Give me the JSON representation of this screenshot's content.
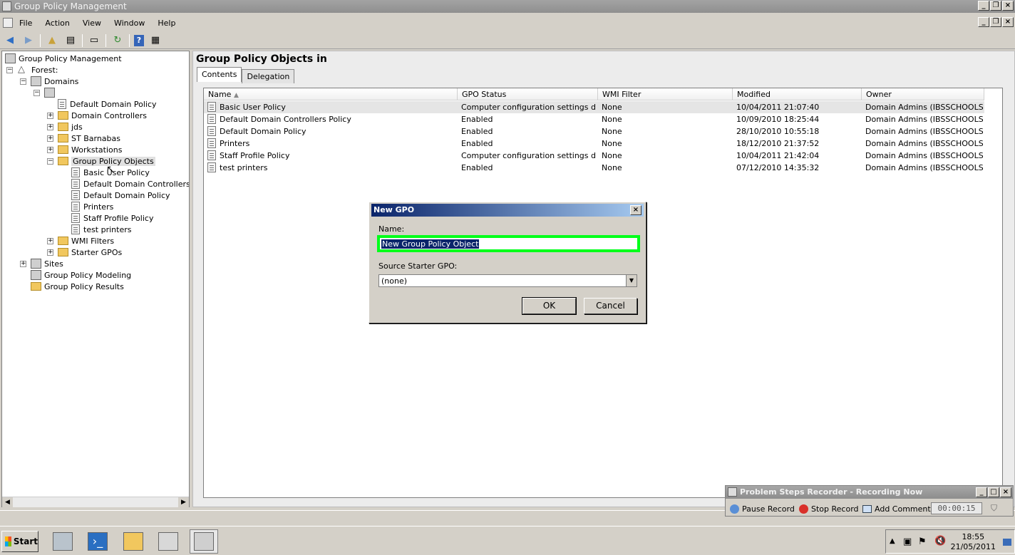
{
  "window": {
    "title": "Group Policy Management"
  },
  "menu": [
    "File",
    "Action",
    "View",
    "Window",
    "Help"
  ],
  "toolbar_icons": [
    "back-arrow-icon",
    "forward-arrow-icon",
    "up-folder-icon",
    "show-hide-tree-icon",
    "properties-icon",
    "refresh-icon",
    "help-icon",
    "console-icon"
  ],
  "tree": {
    "root": "Group Policy Management",
    "forest": "Forest:",
    "domains": "Domains",
    "domain_children": [
      "Default Domain Policy",
      "Domain Controllers",
      "jds",
      "ST Barnabas",
      "Workstations",
      "Group Policy Objects"
    ],
    "gpo_children": [
      "Basic User Policy",
      "Default Domain Controllers Pol",
      "Default Domain Policy",
      "Printers",
      "Staff Profile Policy",
      "test printers"
    ],
    "after_gpo": [
      "WMI Filters",
      "Starter GPOs"
    ],
    "sites": "Sites",
    "modeling": "Group Policy Modeling",
    "results": "Group Policy Results"
  },
  "content": {
    "title": "Group Policy Objects in",
    "tabs": [
      "Contents",
      "Delegation"
    ],
    "columns": [
      "Name",
      "GPO Status",
      "WMI Filter",
      "Modified",
      "Owner"
    ],
    "rows": [
      {
        "name": "Basic User Policy",
        "status": "Computer configuration settings disab...",
        "wmi": "None",
        "modified": "10/04/2011 21:07:40",
        "owner": "Domain Admins (IBSSCHOOLS..."
      },
      {
        "name": "Default Domain Controllers Policy",
        "status": "Enabled",
        "wmi": "None",
        "modified": "10/09/2010 18:25:44",
        "owner": "Domain Admins (IBSSCHOOLS..."
      },
      {
        "name": "Default Domain Policy",
        "status": "Enabled",
        "wmi": "None",
        "modified": "28/10/2010 10:55:18",
        "owner": "Domain Admins (IBSSCHOOLS..."
      },
      {
        "name": "Printers",
        "status": "Enabled",
        "wmi": "None",
        "modified": "18/12/2010 21:37:52",
        "owner": "Domain Admins (IBSSCHOOLS..."
      },
      {
        "name": "Staff Profile Policy",
        "status": "Computer configuration settings disab...",
        "wmi": "None",
        "modified": "10/04/2011 21:42:04",
        "owner": "Domain Admins (IBSSCHOOLS..."
      },
      {
        "name": "test printers",
        "status": "Enabled",
        "wmi": "None",
        "modified": "07/12/2010 14:35:32",
        "owner": "Domain Admins (IBSSCHOOLS..."
      }
    ]
  },
  "dialog": {
    "title": "New GPO",
    "name_label": "Name:",
    "name_value": "New Group Policy Object",
    "source_label": "Source Starter GPO:",
    "source_value": "(none)",
    "ok": "OK",
    "cancel": "Cancel",
    "highlight_color": "#00ff1a"
  },
  "recorder": {
    "title": "Problem Steps Recorder - Recording Now",
    "pause": "Pause Record",
    "stop": "Stop Record",
    "comment": "Add Comment",
    "timer": "00:00:15"
  },
  "taskbar": {
    "start": "Start",
    "time": "18:55",
    "date": "21/05/2011"
  }
}
